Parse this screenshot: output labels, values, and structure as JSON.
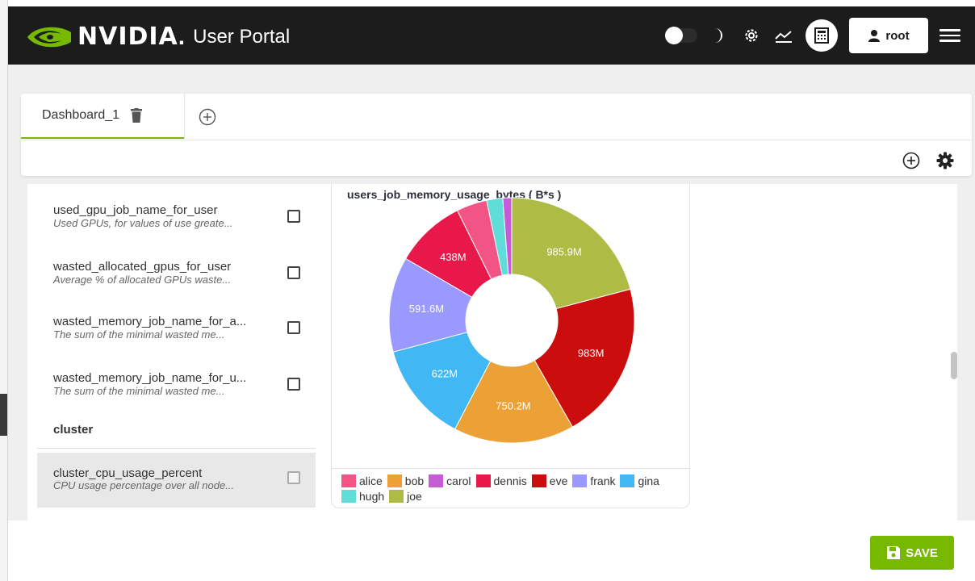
{
  "header": {
    "brand": "NVIDIA",
    "portal_title": "User Portal",
    "user": "root"
  },
  "tabs": [
    {
      "label": "Dashboard_1"
    }
  ],
  "metrics": [
    {
      "name": "used_gpu_job_name_for_user",
      "desc": "Used GPUs, for values of use greate..."
    },
    {
      "name": "wasted_allocated_gpus_for_user",
      "desc": "Average % of allocated GPUs waste..."
    },
    {
      "name": "wasted_memory_job_name_for_a...",
      "desc": "The sum of the minimal wasted me..."
    },
    {
      "name": "wasted_memory_job_name_for_u...",
      "desc": "The sum of the minimal wasted me..."
    }
  ],
  "cluster": {
    "heading": "cluster",
    "metrics": [
      {
        "name": "cluster_cpu_usage_percent",
        "desc": "CPU usage percentage over all node..."
      }
    ]
  },
  "footer": {
    "save_label": "SAVE"
  },
  "colors": {
    "accent": "#76b900",
    "header_bg": "#1c1c1c"
  },
  "chart_data": {
    "type": "pie",
    "title": "users_job_memory_usage_bytes ( B*s )",
    "donut": true,
    "slices": [
      {
        "name": "joe",
        "value": 985.9,
        "label": "985.9M",
        "color": "#aebb45"
      },
      {
        "name": "eve",
        "value": 983,
        "label": "983M",
        "color": "#cc0d0d"
      },
      {
        "name": "bob",
        "value": 750.2,
        "label": "750.2M",
        "color": "#eba135"
      },
      {
        "name": "gina",
        "value": 622,
        "label": "622M",
        "color": "#41b7f4"
      },
      {
        "name": "frank",
        "value": 591.6,
        "label": "591.6M",
        "color": "#9999ff"
      },
      {
        "name": "dennis",
        "value": 438,
        "label": "438M",
        "color": "#e8194a"
      },
      {
        "name": "alice",
        "value": 190,
        "label": "",
        "color": "#f25486"
      },
      {
        "name": "hugh",
        "value": 100,
        "label": "",
        "color": "#5fded9"
      },
      {
        "name": "carol",
        "value": 55,
        "label": "",
        "color": "#c65bd6"
      }
    ],
    "legend": [
      {
        "name": "alice",
        "color": "#f25486"
      },
      {
        "name": "bob",
        "color": "#eba135"
      },
      {
        "name": "carol",
        "color": "#c65bd6"
      },
      {
        "name": "dennis",
        "color": "#e8194a"
      },
      {
        "name": "eve",
        "color": "#cc0d0d"
      },
      {
        "name": "frank",
        "color": "#9999ff"
      },
      {
        "name": "gina",
        "color": "#41b7f4"
      },
      {
        "name": "hugh",
        "color": "#5fded9"
      },
      {
        "name": "joe",
        "color": "#aebb45"
      }
    ],
    "legend_position": "bottom"
  }
}
